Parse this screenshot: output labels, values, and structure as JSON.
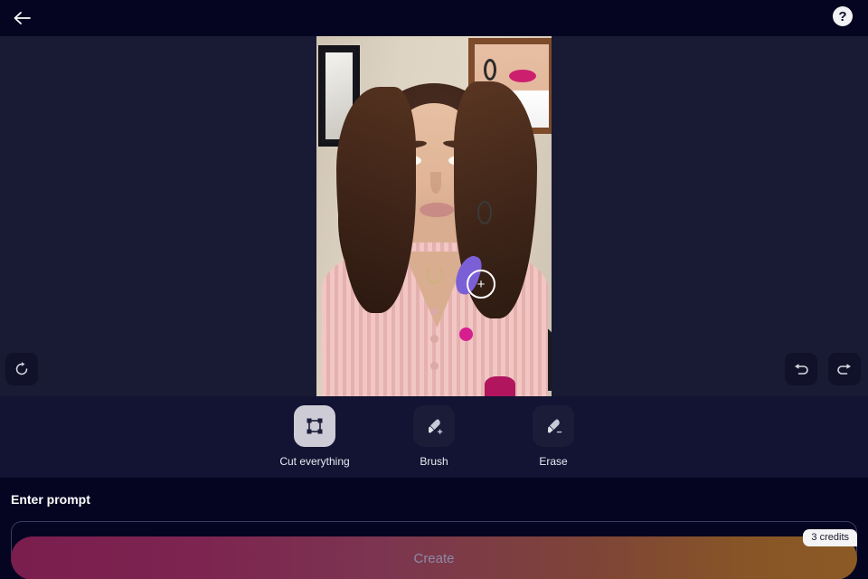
{
  "app": {
    "background_dark": "#050521",
    "background_stage": "#191a33",
    "background_toolbar": "#131333"
  },
  "topbar": {
    "back_icon": "arrow-left-icon",
    "help_icon": "question-mark-icon",
    "help_glyph": "?"
  },
  "canvas": {
    "reset_icon": "refresh-icon",
    "undo_icon": "undo-arrow-icon",
    "redo_icon": "redo-arrow-icon",
    "cursor_glyph": "+",
    "cursor_name": "brush-cursor-ring",
    "image_description": "portrait photo of a woman in a pink ribbed cardigan with framed pictures on a beige wall"
  },
  "toolbar": {
    "tools": [
      {
        "label": "Cut everything",
        "icon": "crop-frame-icon",
        "selected": true
      },
      {
        "label": "Brush",
        "icon": "brush-plus-icon",
        "selected": false
      },
      {
        "label": "Erase",
        "icon": "brush-minus-icon",
        "selected": false
      }
    ]
  },
  "prompt": {
    "label": "Enter prompt",
    "value": "",
    "placeholder": ""
  },
  "create": {
    "label": "Create",
    "credits_badge": "3 credits",
    "gradient_start": "#7a1e4e",
    "gradient_end": "#8b5a25"
  }
}
